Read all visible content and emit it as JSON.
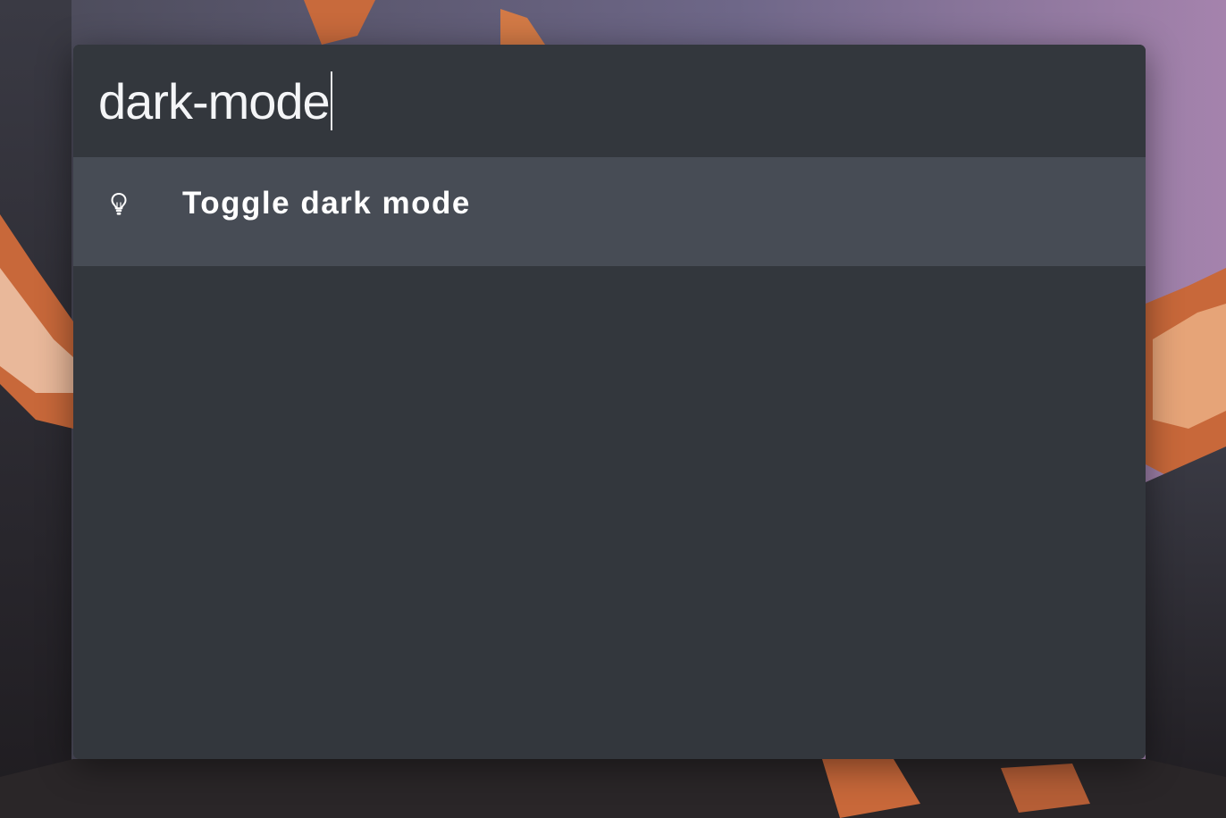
{
  "search": {
    "query": "dark-mode"
  },
  "results": [
    {
      "label": "Toggle dark mode",
      "icon": "lightbulb-icon",
      "selected": true
    }
  ],
  "colors": {
    "window_background": "#33373d",
    "selected_row": "#474c55",
    "text": "#ffffff"
  }
}
